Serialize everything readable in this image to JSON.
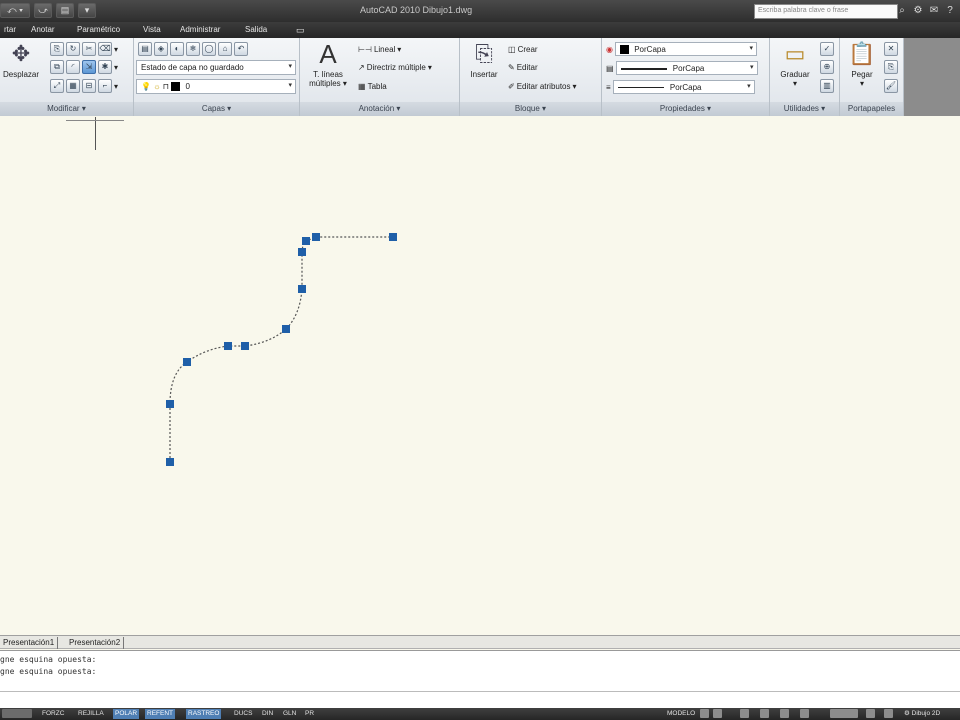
{
  "title_bar": {
    "title": "AutoCAD 2010    Dibujo1.dwg",
    "search_placeholder": "Escriba palabra clave o frase"
  },
  "menu_tabs": [
    "rtar",
    "Anotar",
    "Paramétrico",
    "Vista",
    "Administrar",
    "Salida"
  ],
  "ribbon": {
    "modify": {
      "title": "Modificar",
      "move_label": "Desplazar"
    },
    "layers": {
      "title": "Capas",
      "layer_state": "Estado de capa no guardado",
      "current_layer": "0"
    },
    "annotation": {
      "title": "Anotación",
      "mtext_label_1": "T. líneas",
      "mtext_label_2": "múltiples",
      "linear": "Lineal",
      "multileader": "Directriz múltiple",
      "table": "Tabla"
    },
    "block": {
      "title": "Bloque",
      "insert": "Insertar",
      "create": "Crear",
      "edit": "Editar",
      "edit_attributes": "Editar atributos"
    },
    "properties": {
      "title": "Propiedades",
      "color": "PorCapa",
      "linetype": "PorCapa",
      "lineweight": "PorCapa"
    },
    "utilities": {
      "title": "Utilidades",
      "measure": "Graduar"
    },
    "clipboard": {
      "title": "Portapapeles",
      "paste": "Pegar"
    }
  },
  "layout_tabs": [
    "Presentación1",
    "Presentación2"
  ],
  "command_history": [
    "gne esquina opuesta:",
    "gne esquina opuesta:"
  ],
  "status_bar": {
    "toggles": [
      {
        "label": "FORZC",
        "on": false
      },
      {
        "label": "REJILLA",
        "on": false
      },
      {
        "label": "POLAR",
        "on": true
      },
      {
        "label": "REFENT",
        "on": true
      },
      {
        "label": "RASTREO",
        "on": true
      },
      {
        "label": "DUCS",
        "on": false
      },
      {
        "label": "DIN",
        "on": false
      },
      {
        "label": "GLN",
        "on": false
      },
      {
        "label": "PR",
        "on": false
      }
    ],
    "model_label": "MODELO",
    "workspace": "Dibujo 2D"
  },
  "colors": {
    "canvas_bg": "#f9f8ec",
    "grip_blue": "#1f5fa8",
    "polar_active": "#4f7fb4"
  }
}
